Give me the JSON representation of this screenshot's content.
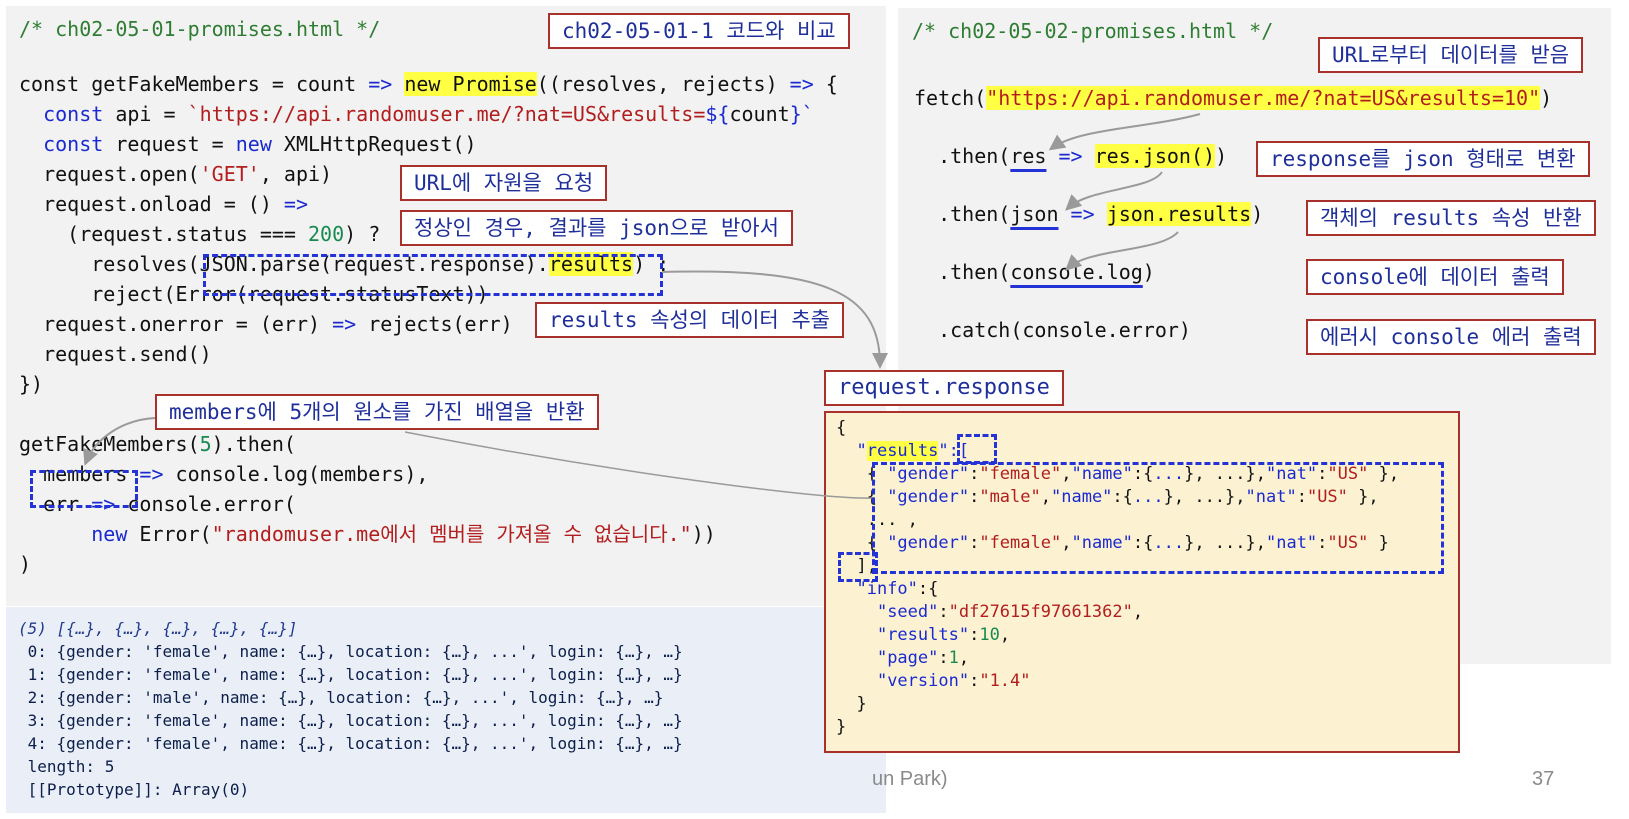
{
  "left_code": {
    "file_comment": "/* ch02-05-01-promises.html */",
    "lines": [
      [
        [
          "const getFakeMembers = count ",
          ""
        ],
        [
          "=>",
          "kw"
        ],
        [
          " ",
          ""
        ],
        [
          "new Promise",
          "hl"
        ],
        [
          "((resolves, rejects) ",
          ""
        ],
        [
          "=>",
          "kw"
        ],
        [
          " {",
          ""
        ]
      ],
      [
        [
          "  ",
          ""
        ],
        [
          "const",
          "kw"
        ],
        [
          " api = ",
          ""
        ],
        [
          "`https://api.randomuser.me/?nat=US&results=",
          "str"
        ],
        [
          "${",
          "kw"
        ],
        [
          "count",
          ""
        ],
        [
          "}`",
          "kw"
        ]
      ],
      [
        [
          "  ",
          ""
        ],
        [
          "const",
          "kw"
        ],
        [
          " request = ",
          ""
        ],
        [
          "new",
          "kw"
        ],
        [
          " XMLHttpRequest()",
          ""
        ]
      ],
      [
        [
          "  request.open(",
          ""
        ],
        [
          "'GET'",
          "str"
        ],
        [
          ", api)",
          ""
        ]
      ],
      [
        [
          "  request.onload = () ",
          ""
        ],
        [
          "=>",
          "kw"
        ]
      ],
      [
        [
          "    (request.status === ",
          ""
        ],
        [
          "200",
          "num"
        ],
        [
          ") ?",
          ""
        ]
      ],
      [
        [
          "      resolves(JSON.parse(request.response).",
          ""
        ],
        [
          "results",
          "hl"
        ],
        [
          ") :",
          ""
        ]
      ],
      [
        [
          "      reject(Error(request.statusText))",
          ""
        ]
      ],
      [
        [
          "  request.onerror = (err) ",
          ""
        ],
        [
          "=>",
          "kw"
        ],
        [
          " rejects(err)",
          ""
        ]
      ],
      [
        [
          "  request.send()",
          ""
        ]
      ],
      [
        [
          "})",
          ""
        ]
      ],
      [
        [
          "",
          ""
        ]
      ],
      [
        [
          "getFakeMembers(",
          ""
        ],
        [
          "5",
          "num"
        ],
        [
          ").then(",
          ""
        ]
      ],
      [
        [
          "  members ",
          ""
        ],
        [
          "=>",
          "kw"
        ],
        [
          " console.log(members),",
          ""
        ]
      ],
      [
        [
          "  err ",
          ""
        ],
        [
          "=>",
          "kw"
        ],
        [
          " console.error(",
          ""
        ]
      ],
      [
        [
          "      ",
          ""
        ],
        [
          "new",
          "kw"
        ],
        [
          " Error(",
          ""
        ],
        [
          "\"randomuser.me에서 멤버를 가져올 수 없습니다.\"",
          "str"
        ],
        [
          "))",
          ""
        ]
      ],
      [
        [
          ")",
          ""
        ]
      ]
    ]
  },
  "right_code": {
    "file_comment": "/* ch02-05-02-promises.html */",
    "lines": [
      [
        [
          "fetch(",
          ""
        ],
        [
          "\"https://api.randomuser.me/?nat=US&results=10\"",
          "str hl"
        ],
        [
          ")",
          ""
        ]
      ],
      [
        [
          "  .then(",
          ""
        ],
        [
          "res",
          "ul"
        ],
        [
          " ",
          ""
        ],
        [
          "=>",
          "kw"
        ],
        [
          " ",
          ""
        ],
        [
          "res.json()",
          "hl"
        ],
        [
          ")",
          ""
        ]
      ],
      [
        [
          "  .then(",
          ""
        ],
        [
          "json",
          "ul"
        ],
        [
          " ",
          ""
        ],
        [
          "=>",
          "kw"
        ],
        [
          " ",
          ""
        ],
        [
          "json.results",
          "hl"
        ],
        [
          ")",
          ""
        ]
      ],
      [
        [
          "  .then(",
          ""
        ],
        [
          "console.log",
          "ul"
        ],
        [
          ")",
          ""
        ]
      ],
      [
        [
          "  .catch(console.error)",
          ""
        ]
      ]
    ]
  },
  "annotations": {
    "compare": "ch02-05-01-1 코드와 비교",
    "url_request": "URL에 자원을 요청",
    "success_json": "정상인 경우, 결과를 json으로 받아서",
    "results_extract": "results 속성의 데이터 추출",
    "members_array": "members에 5개의 원소를 가진 배열을 반환",
    "receive_data": "URL로부터 데이터를 받음",
    "to_json": "response를 json 형태로 변환",
    "return_results": "객체의 results 속성 반환",
    "console_out": "console에 데이터 출력",
    "error_out": "에러시 console 에러 출력",
    "request_response": "request.response"
  },
  "response_json": {
    "lines": [
      [
        [
          "{",
          ""
        ]
      ],
      [
        [
          "  \"",
          "kw"
        ],
        [
          "results",
          "hl kw"
        ],
        [
          "\":[",
          "kw"
        ]
      ],
      [
        [
          "   { ",
          ""
        ],
        [
          "\"gender\"",
          "kw"
        ],
        [
          ":",
          ""
        ],
        [
          "\"female\"",
          "str"
        ],
        [
          ",",
          ""
        ],
        [
          "\"name\"",
          "kw"
        ],
        [
          ":{",
          ""
        ],
        [
          "...",
          "kw"
        ],
        [
          "}, ...},",
          ""
        ],
        [
          "\"nat\"",
          "kw"
        ],
        [
          ":",
          ""
        ],
        [
          "\"US\"",
          "str"
        ],
        [
          " },",
          ""
        ]
      ],
      [
        [
          "   { ",
          ""
        ],
        [
          "\"gender\"",
          "kw"
        ],
        [
          ":",
          ""
        ],
        [
          "\"male\"",
          "str"
        ],
        [
          ",",
          ""
        ],
        [
          "\"name\"",
          "kw"
        ],
        [
          ":{",
          ""
        ],
        [
          "...",
          "kw"
        ],
        [
          "}, ...},",
          ""
        ],
        [
          "\"nat\"",
          "kw"
        ],
        [
          ":",
          ""
        ],
        [
          "\"US\"",
          "str"
        ],
        [
          " },",
          ""
        ]
      ],
      [
        [
          "   ... ,",
          ""
        ]
      ],
      [
        [
          "   { ",
          ""
        ],
        [
          "\"gender\"",
          "kw"
        ],
        [
          ":",
          ""
        ],
        [
          "\"female\"",
          "str"
        ],
        [
          ",",
          ""
        ],
        [
          "\"name\"",
          "kw"
        ],
        [
          ":{",
          ""
        ],
        [
          "...",
          "kw"
        ],
        [
          "}, ...},",
          ""
        ],
        [
          "\"nat\"",
          "kw"
        ],
        [
          ":",
          ""
        ],
        [
          "\"US\"",
          "str"
        ],
        [
          " }",
          ""
        ]
      ],
      [
        [
          "  ],",
          ""
        ]
      ],
      [
        [
          "  ",
          ""
        ],
        [
          "\"info\"",
          "kw"
        ],
        [
          ":{",
          ""
        ]
      ],
      [
        [
          "    ",
          ""
        ],
        [
          "\"seed\"",
          "kw"
        ],
        [
          ":",
          ""
        ],
        [
          "\"df27615f97661362\"",
          "str"
        ],
        [
          ",",
          ""
        ]
      ],
      [
        [
          "    ",
          ""
        ],
        [
          "\"results\"",
          "kw"
        ],
        [
          ":",
          ""
        ],
        [
          "10",
          "num"
        ],
        [
          ",",
          ""
        ]
      ],
      [
        [
          "    ",
          ""
        ],
        [
          "\"page\"",
          "kw"
        ],
        [
          ":",
          ""
        ],
        [
          "1",
          "num"
        ],
        [
          ",",
          ""
        ]
      ],
      [
        [
          "    ",
          ""
        ],
        [
          "\"version\"",
          "kw"
        ],
        [
          ":",
          ""
        ],
        [
          "\"1.4\"",
          "str"
        ]
      ],
      [
        [
          "  }",
          ""
        ]
      ],
      [
        [
          "}",
          ""
        ]
      ]
    ]
  },
  "console_output": {
    "header": "(5) [{…}, {…}, {…}, {…}, {…}]",
    "lines": [
      " 0: {gender: 'female', name: {…}, location: {…}, ...', login: {…}, …}",
      " 1: {gender: 'female', name: {…}, location: {…}, ...', login: {…}, …}",
      " 2: {gender: 'male', name: {…}, location: {…}, ...', login: {…}, …}",
      " 3: {gender: 'female', name: {…}, location: {…}, ...', login: {…}, …}",
      " 4: {gender: 'female', name: {…}, location: {…}, ...', login: {…}, …}",
      " length: 5",
      " [[Prototype]]: Array(0)"
    ]
  },
  "footer": {
    "author_fragment": "un Park)",
    "page_number": "37"
  }
}
